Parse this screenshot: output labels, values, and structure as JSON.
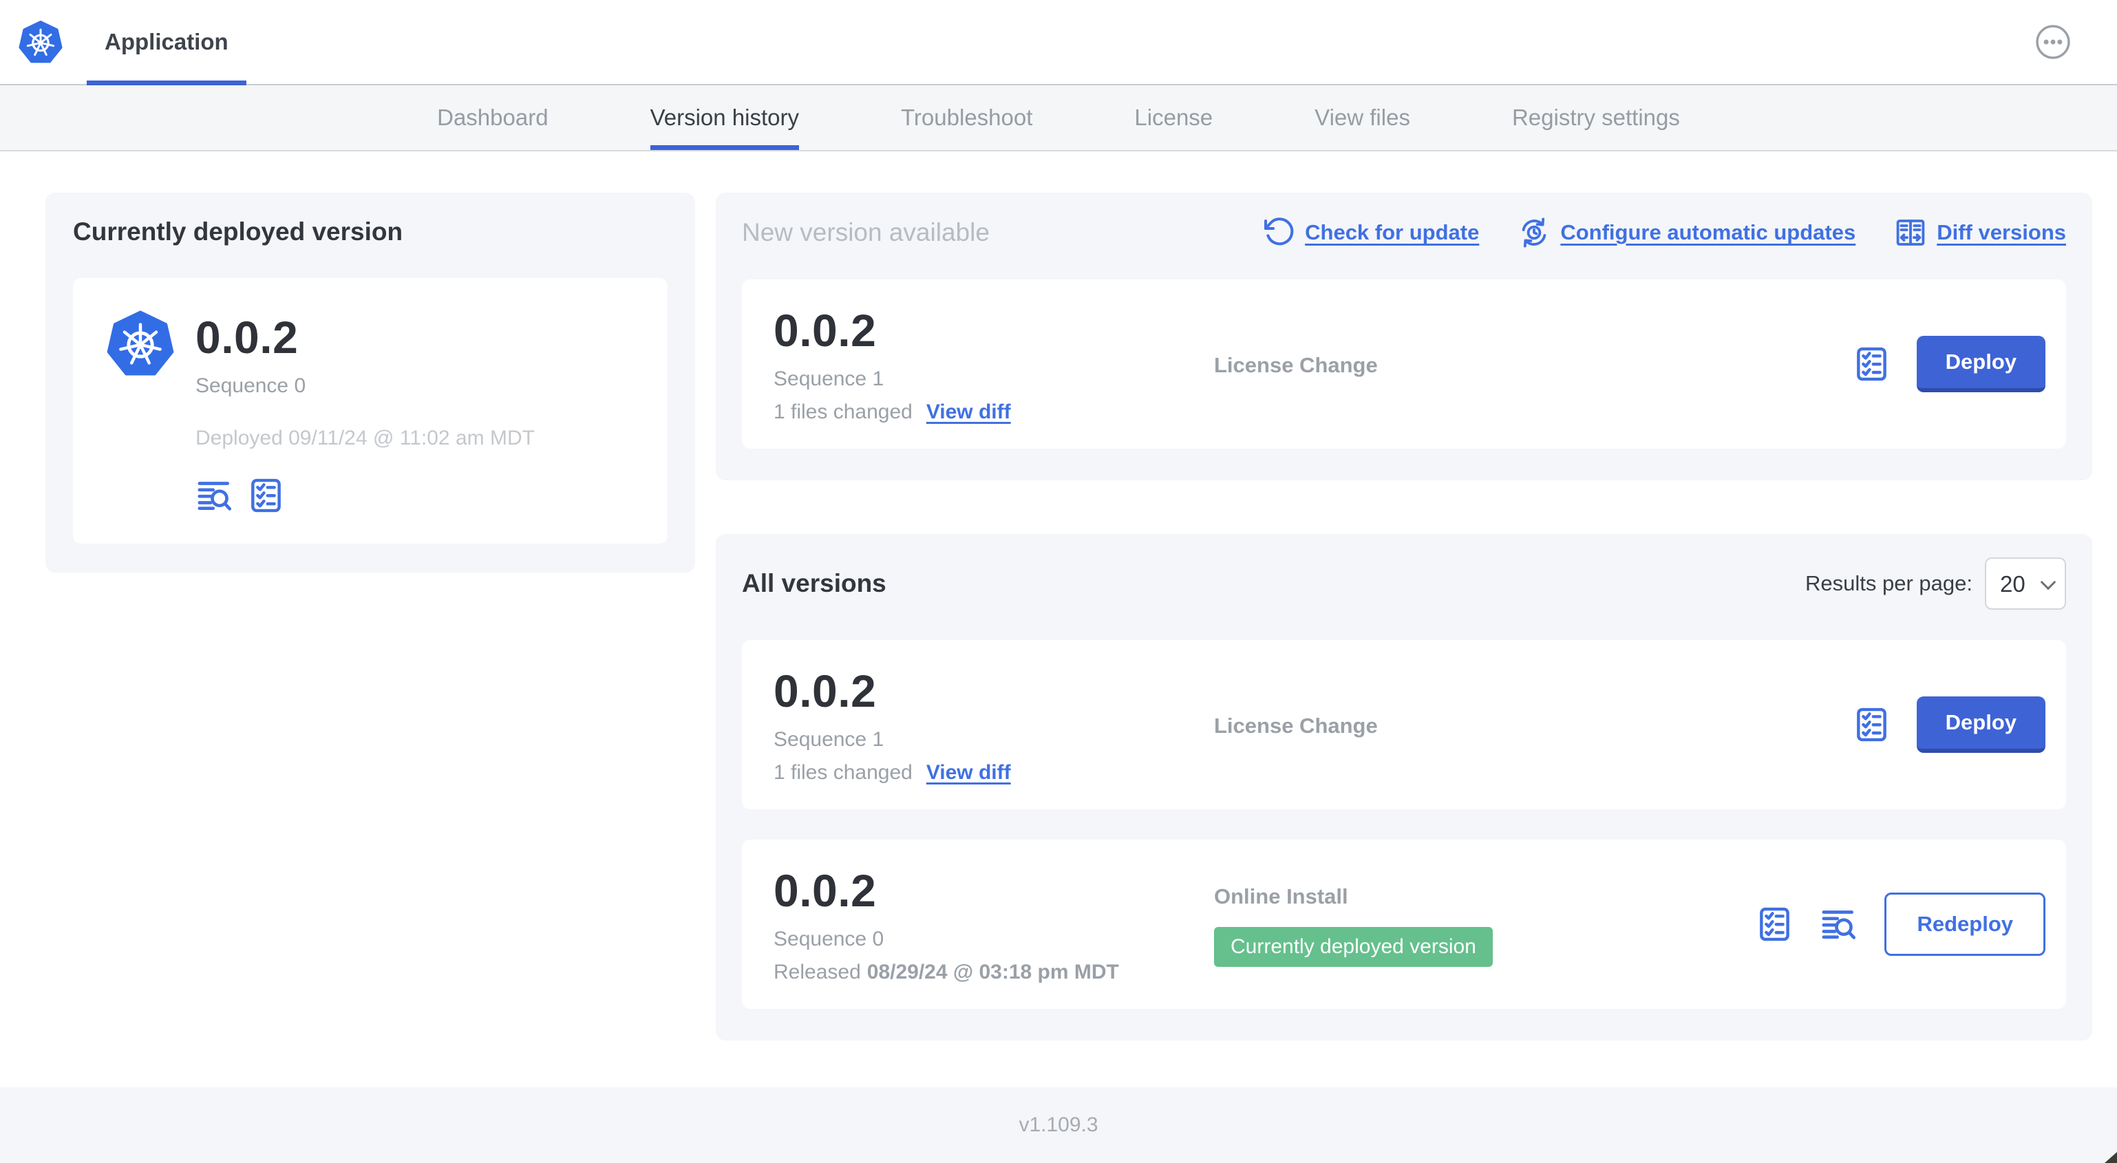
{
  "header": {
    "app_tab": "Application"
  },
  "nav": {
    "tabs": [
      "Dashboard",
      "Version history",
      "Troubleshoot",
      "License",
      "View files",
      "Registry settings"
    ],
    "active": "Version history"
  },
  "current_version": {
    "title": "Currently deployed version",
    "version": "0.0.2",
    "sequence": "Sequence 0",
    "deployed": "Deployed 09/11/24 @ 11:02 am MDT"
  },
  "new_version": {
    "title": "New version available",
    "actions": {
      "check_for_update": "Check for update",
      "configure_updates": "Configure automatic updates",
      "diff_versions": "Diff versions"
    },
    "card": {
      "version": "0.0.2",
      "sequence": "Sequence 1",
      "files_changed": "1 files changed",
      "view_diff": "View diff",
      "source": "License Change",
      "action": "Deploy"
    }
  },
  "all_versions": {
    "title": "All versions",
    "results_per_page_label": "Results per page:",
    "results_per_page": "20",
    "rows": [
      {
        "version": "0.0.2",
        "sequence": "Sequence 1",
        "files_changed": "1 files changed",
        "view_diff": "View diff",
        "source": "License Change",
        "action": "Deploy"
      },
      {
        "version": "0.0.2",
        "sequence": "Sequence 0",
        "released_prefix": "Released",
        "released_date": "08/29/24 @ 03:18 pm MDT",
        "source": "Online Install",
        "badge": "Currently deployed version",
        "action": "Redeploy"
      }
    ]
  },
  "footer": {
    "version": "v1.109.3"
  },
  "colors": {
    "accent_blue": "#3E63D5",
    "link_blue": "#4070E2",
    "kubernetes_blue": "#326DE6",
    "badge_green": "#65C08D",
    "panel_gray": "#F4F6F9"
  }
}
